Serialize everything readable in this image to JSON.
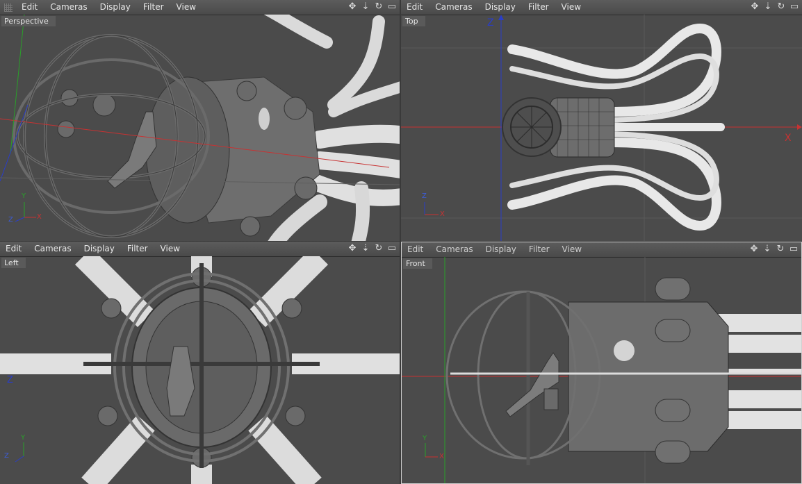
{
  "menus": [
    "Edit",
    "Cameras",
    "Display",
    "Filter",
    "View"
  ],
  "viewports": {
    "perspective": {
      "label": "Perspective"
    },
    "top": {
      "label": "Top",
      "axis_big_z": "Z",
      "axis_big_x": "X"
    },
    "left": {
      "label": "Left",
      "axis_big_z": "Z"
    },
    "front": {
      "label": "Front"
    }
  },
  "gizmo": {
    "x": "X",
    "y": "Y",
    "z": "Z"
  },
  "nav_icons": [
    "move-icon",
    "scale-icon",
    "rotate-icon",
    "maximize-icon"
  ],
  "colors": {
    "bg": "#4b4b4b",
    "menubar": "#525252",
    "axis_red": "#c83232",
    "axis_green": "#2aa02a",
    "axis_blue": "#2a3ec8"
  }
}
